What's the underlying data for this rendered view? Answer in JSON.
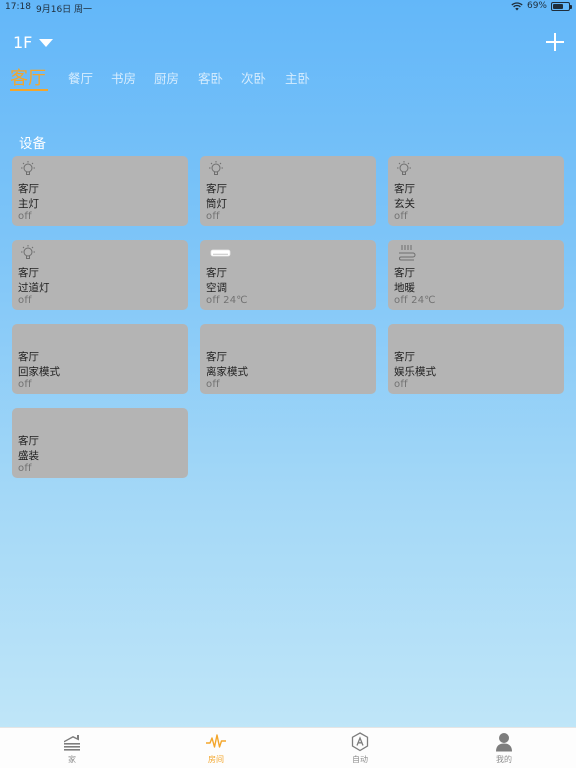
{
  "status_bar": {
    "time": "17:18",
    "date": "9月16日 周一",
    "battery_text": "69%",
    "battery_level": 0.69
  },
  "header": {
    "floor": "1F",
    "add_icon": "plus-icon"
  },
  "room_tabs": [
    "客厅",
    "餐厅",
    "书房",
    "厨房",
    "客卧",
    "次卧",
    "主卧"
  ],
  "active_room_tab": 0,
  "section": {
    "title": "设备"
  },
  "devices": [
    {
      "room": "客厅",
      "name": "主灯",
      "state": "off",
      "icon": "bulb-icon"
    },
    {
      "room": "客厅",
      "name": "筒灯",
      "state": "off",
      "icon": "bulb-icon"
    },
    {
      "room": "客厅",
      "name": "玄关",
      "state": "off",
      "icon": "bulb-icon"
    },
    {
      "room": "客厅",
      "name": "过道灯",
      "state": "off",
      "icon": "bulb-icon"
    },
    {
      "room": "客厅",
      "name": "空调",
      "state": "off 24℃",
      "icon": "air-conditioner-icon"
    },
    {
      "room": "客厅",
      "name": "地暖",
      "state": "off 24℃",
      "icon": "floor-heating-icon"
    },
    {
      "room": "客厅",
      "name": "回家模式",
      "state": "off",
      "icon": ""
    },
    {
      "room": "客厅",
      "name": "离家模式",
      "state": "off",
      "icon": ""
    },
    {
      "room": "客厅",
      "name": "娱乐模式",
      "state": "off",
      "icon": ""
    },
    {
      "room": "客厅",
      "name": "盛装",
      "state": "off",
      "icon": ""
    }
  ],
  "tab_bar": {
    "items": [
      {
        "label": "家",
        "icon": "home-icon"
      },
      {
        "label": "房间",
        "icon": "pulse-icon"
      },
      {
        "label": "自动",
        "icon": "automation-icon"
      },
      {
        "label": "我的",
        "icon": "person-icon"
      }
    ],
    "active": 1
  },
  "colors": {
    "accent": "#f3a62c",
    "card": "#b4b4b4",
    "background_top": "#63b7f9",
    "background_bottom": "#c4e8f8"
  }
}
